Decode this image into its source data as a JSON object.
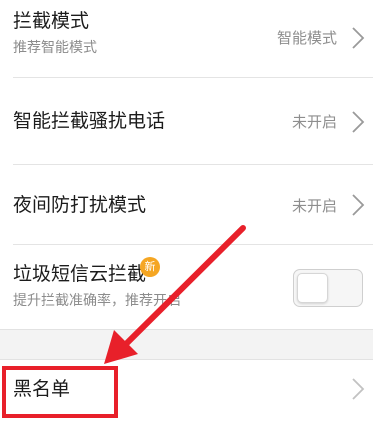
{
  "settings": {
    "items": [
      {
        "title": "拦截模式",
        "subtitle": "推荐智能模式",
        "value": "智能模式"
      },
      {
        "title": "智能拦截骚扰电话",
        "value": "未开启"
      },
      {
        "title": "夜间防打扰模式",
        "value": "未开启"
      },
      {
        "title": "垃圾短信云拦截",
        "subtitle": "提升拦截准确率，推荐开启",
        "toggle_on": false,
        "badge": "新"
      }
    ],
    "blacklist": {
      "title": "黑名单"
    }
  },
  "colors": {
    "annotation": "#e8202a",
    "badge": "#f5a623",
    "secondary_text": "#8c8c8c"
  },
  "icons": [
    "chevron-right-icon",
    "new-badge-icon",
    "annotation-arrow"
  ]
}
